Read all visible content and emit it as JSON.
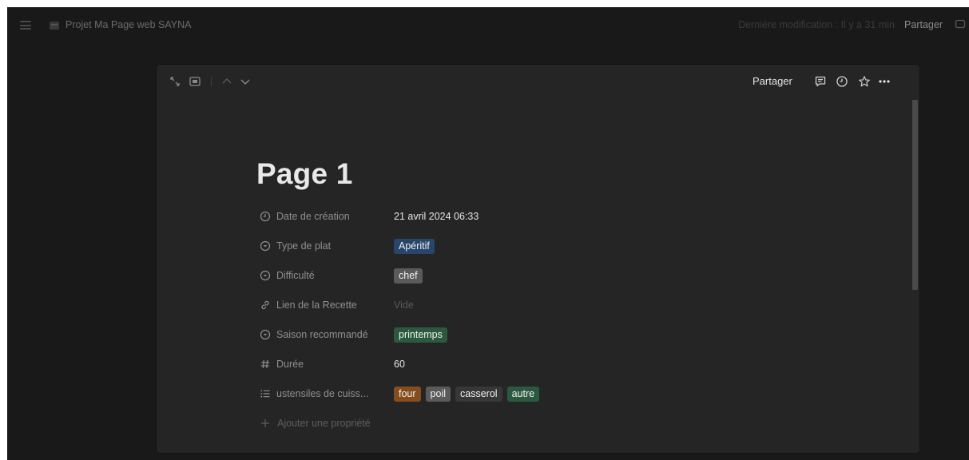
{
  "topbar": {
    "breadcrumb": "Projet Ma Page web SAYNA",
    "last_edit": "Dernière modification : Il y a 31 min",
    "share_label": "Partager"
  },
  "modal": {
    "share_label": "Partager",
    "title": "Page 1",
    "properties": [
      {
        "name": "created-time",
        "icon": "clock-icon",
        "label": "Date de création",
        "value": "21 avril 2024 06:33"
      },
      {
        "name": "dish-type",
        "icon": "select-icon",
        "label": "Type de plat",
        "tags": [
          {
            "text": "Apéritif",
            "color": "#28456c"
          }
        ]
      },
      {
        "name": "difficulty",
        "icon": "select-icon",
        "label": "Difficulté",
        "tags": [
          {
            "text": "chef",
            "color": "#5a5a5a"
          }
        ]
      },
      {
        "name": "recipe-link",
        "icon": "link-icon",
        "label": "Lien de la Recette",
        "value": "Vide",
        "empty": true
      },
      {
        "name": "season",
        "icon": "select-icon",
        "label": "Saison recommandé",
        "tags": [
          {
            "text": "printemps",
            "color": "#2b593f"
          }
        ]
      },
      {
        "name": "duration",
        "icon": "number-icon",
        "label": "Durée",
        "value": "60"
      },
      {
        "name": "utensils",
        "icon": "multi-select-icon",
        "label": "ustensiles de cuiss...",
        "tags": [
          {
            "text": "four",
            "color": "#854c1d"
          },
          {
            "text": "poil",
            "color": "#5a5a5a"
          },
          {
            "text": "casserol",
            "color": "#373737"
          },
          {
            "text": "autre",
            "color": "#2b593f"
          }
        ]
      }
    ],
    "add_property": "Ajouter une propriété"
  },
  "colors": {
    "app_bg": "#191919",
    "modal_bg": "#252525",
    "text_primary": "#e6e6e6",
    "text_muted": "#8f8f8f"
  }
}
